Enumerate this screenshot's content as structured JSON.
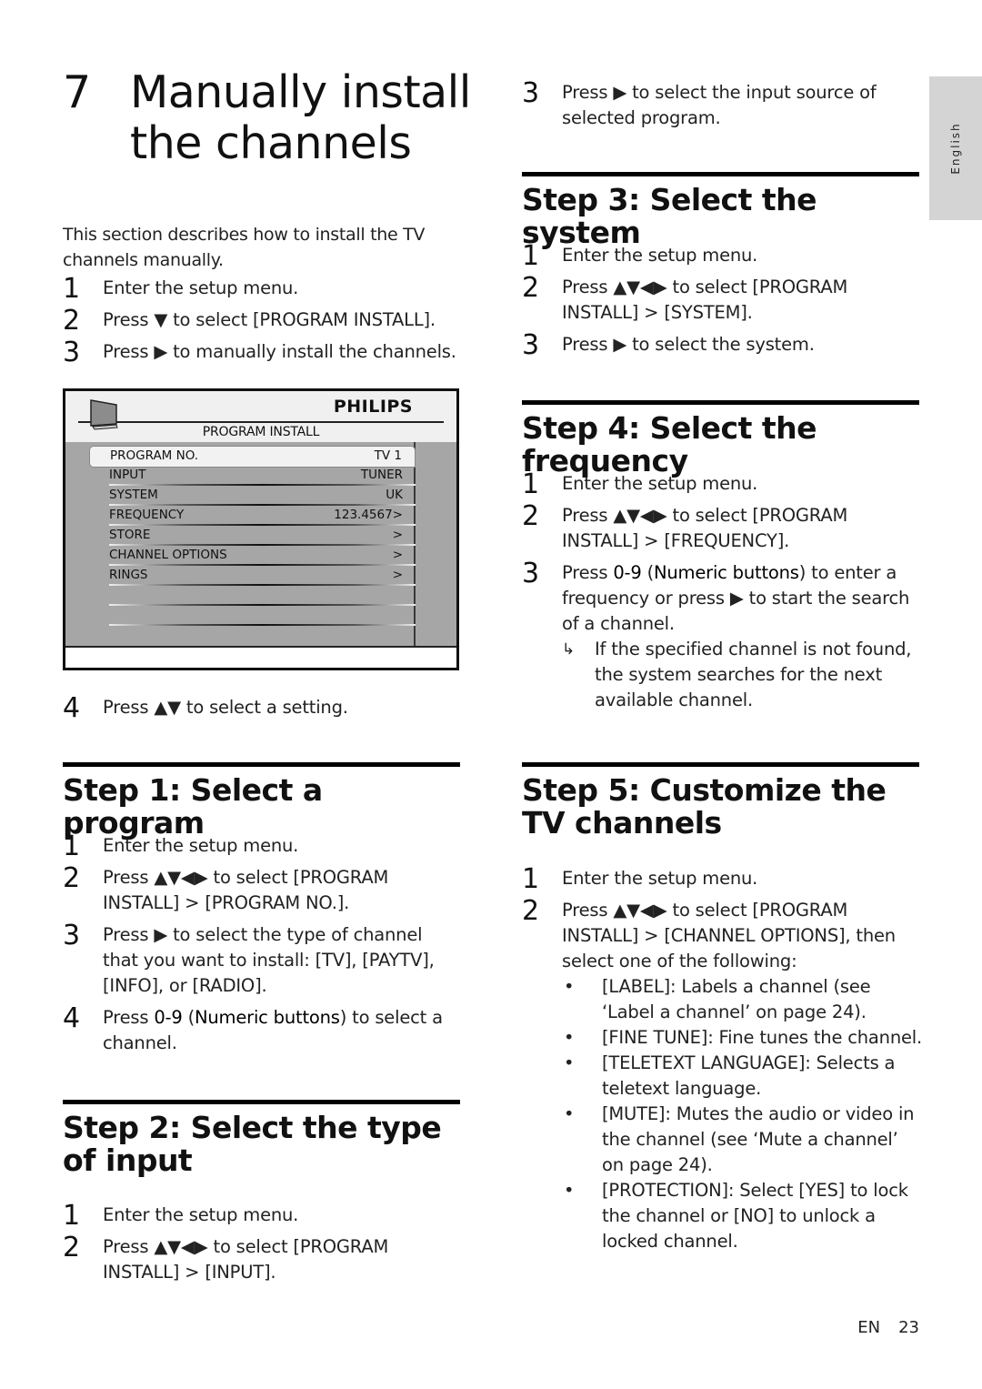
{
  "chapter": {
    "number": "7",
    "title": "Manually install the channels"
  },
  "intro": "This section describes how to install the TV channels manually.",
  "intro_steps": [
    {
      "n": "1",
      "text": "Enter the setup menu."
    },
    {
      "n": "2",
      "text": "Press ▼ to select [PROGRAM INSTALL]."
    },
    {
      "n": "3",
      "text": "Press ▶ to manually install the channels."
    }
  ],
  "tv_menu": {
    "brand": "PHILIPS",
    "title": "PROGRAM INSTALL",
    "rows": [
      {
        "label": "PROGRAM NO.",
        "value": "TV 1",
        "selected": true
      },
      {
        "label": "INPUT",
        "value": "TUNER"
      },
      {
        "label": "SYSTEM",
        "value": "UK"
      },
      {
        "label": "FREQUENCY",
        "value": "123.4567>"
      },
      {
        "label": "STORE",
        "value": ">"
      },
      {
        "label": "CHANNEL OPTIONS",
        "value": ">"
      },
      {
        "label": "RINGS",
        "value": ">"
      },
      {
        "label": "",
        "value": ""
      },
      {
        "label": "",
        "value": ""
      }
    ]
  },
  "after_menu_step": {
    "n": "4",
    "text": "Press ▲▼ to select a setting."
  },
  "sections": {
    "step1": {
      "title": "Step 1: Select a program",
      "steps": [
        {
          "n": "1",
          "text": "Enter the setup menu."
        },
        {
          "n": "2",
          "text": "Press ▲▼◀▶ to select [PROGRAM INSTALL] > [PROGRAM NO.]."
        },
        {
          "n": "3",
          "text": "Press ▶ to select the type of channel that you want to install: [TV], [PAYTV],[INFO], or [RADIO]."
        },
        {
          "n": "4",
          "text_pre": "Press ",
          "bold1": "0-9",
          "text_mid": " (",
          "bold2": "Numeric buttons",
          "text_post": ") to select a channel."
        }
      ]
    },
    "step2": {
      "title": "Step 2: Select the type of input",
      "steps": [
        {
          "n": "1",
          "text": "Enter the setup menu."
        },
        {
          "n": "2",
          "text": "Press ▲▼◀▶ to select [PROGRAM INSTALL] > [INPUT]."
        },
        {
          "n": "3",
          "text": "Press ▶ to select the input source of selected program."
        }
      ]
    },
    "step3": {
      "title": "Step 3: Select the system",
      "steps": [
        {
          "n": "1",
          "text": "Enter the setup menu."
        },
        {
          "n": "2",
          "text": "Press ▲▼◀▶ to select [PROGRAM INSTALL] > [SYSTEM]."
        },
        {
          "n": "3",
          "text": "Press ▶ to select the system."
        }
      ]
    },
    "step4": {
      "title": "Step 4: Select the frequency",
      "steps": [
        {
          "n": "1",
          "text": "Enter the setup menu."
        },
        {
          "n": "2",
          "text": "Press ▲▼◀▶ to select [PROGRAM INSTALL] > [FREQUENCY]."
        },
        {
          "n": "3",
          "text_pre": "Press ",
          "bold1": "0-9",
          "text_mid": " (",
          "bold2": "Numeric buttons",
          "text_post": ") to enter a frequency or press ▶ to start the search of a channel."
        }
      ],
      "note_arrow": "↳",
      "note": "If the specified channel is not found, the system searches for the next available channel."
    },
    "step5": {
      "title": "Step 5: Customize the TV channels",
      "steps": [
        {
          "n": "1",
          "text": "Enter the setup menu."
        },
        {
          "n": "2",
          "text": "Press ▲▼◀▶ to select [PROGRAM INSTALL] > [CHANNEL OPTIONS], then select one of the following:"
        }
      ],
      "bullets": [
        {
          "key": "[LABEL]",
          "text": ": Labels a channel (see ‘Label a channel’ on page 24)."
        },
        {
          "key": "[FINE TUNE]",
          "text": ": Fine tunes the channel."
        },
        {
          "key": "[TELETEXT LANGUAGE]",
          "text": ": Selects a teletext language."
        },
        {
          "key": "[MUTE]",
          "text": ": Mutes the audio or video in the channel (see ‘Mute a channel’ on page 24)."
        },
        {
          "key": "[PROTECTION]",
          "text_a": ": Select ",
          "k2": "[YES]",
          "text_b": " to lock the channel or ",
          "k3": "[NO]",
          "text_c": " to unlock a locked channel."
        }
      ]
    }
  },
  "language_tab": "English",
  "footer": {
    "lang": "EN",
    "page": "23"
  }
}
